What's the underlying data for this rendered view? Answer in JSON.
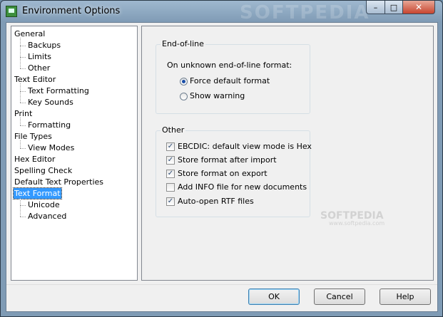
{
  "window": {
    "title": "Environment Options",
    "watermark": "SOFTPEDIA",
    "close_glyph": "✕",
    "min_glyph": "–",
    "max_glyph": "□"
  },
  "tree": {
    "items": [
      {
        "label": "General",
        "level": 0
      },
      {
        "label": "Backups",
        "level": 1
      },
      {
        "label": "Limits",
        "level": 1
      },
      {
        "label": "Other",
        "level": 1
      },
      {
        "label": "Text Editor",
        "level": 0
      },
      {
        "label": "Text Formatting",
        "level": 1
      },
      {
        "label": "Key Sounds",
        "level": 1
      },
      {
        "label": "Print",
        "level": 0
      },
      {
        "label": "Formatting",
        "level": 1
      },
      {
        "label": "File Types",
        "level": 0
      },
      {
        "label": "View Modes",
        "level": 1
      },
      {
        "label": "Hex Editor",
        "level": 0
      },
      {
        "label": "Spelling Check",
        "level": 0
      },
      {
        "label": "Default Text Properties",
        "level": 0
      },
      {
        "label": "Text Format",
        "level": 0,
        "selected": true
      },
      {
        "label": "Unicode",
        "level": 1
      },
      {
        "label": "Advanced",
        "level": 1
      }
    ]
  },
  "eol": {
    "title": "End-of-line",
    "prompt": "On unknown end-of-line format:",
    "options": [
      {
        "label": "Force default format",
        "selected": true
      },
      {
        "label": "Show warning",
        "selected": false
      }
    ]
  },
  "other": {
    "title": "Other",
    "checks": [
      {
        "label": "EBCDIC: default view mode is Hex",
        "checked": true
      },
      {
        "label": "Store format after import",
        "checked": true
      },
      {
        "label": "Store format on export",
        "checked": true
      },
      {
        "label": "Add INFO file for new documents",
        "checked": false
      },
      {
        "label": "Auto-open RTF files",
        "checked": true
      }
    ]
  },
  "watermark": {
    "main": "SOFTPEDIA",
    "sub": "www.softpedia.com"
  },
  "buttons": {
    "ok": "OK",
    "cancel": "Cancel",
    "help": "Help"
  },
  "colors": {
    "selection": "#3399ff",
    "titlebar": "#8ea9c3"
  }
}
